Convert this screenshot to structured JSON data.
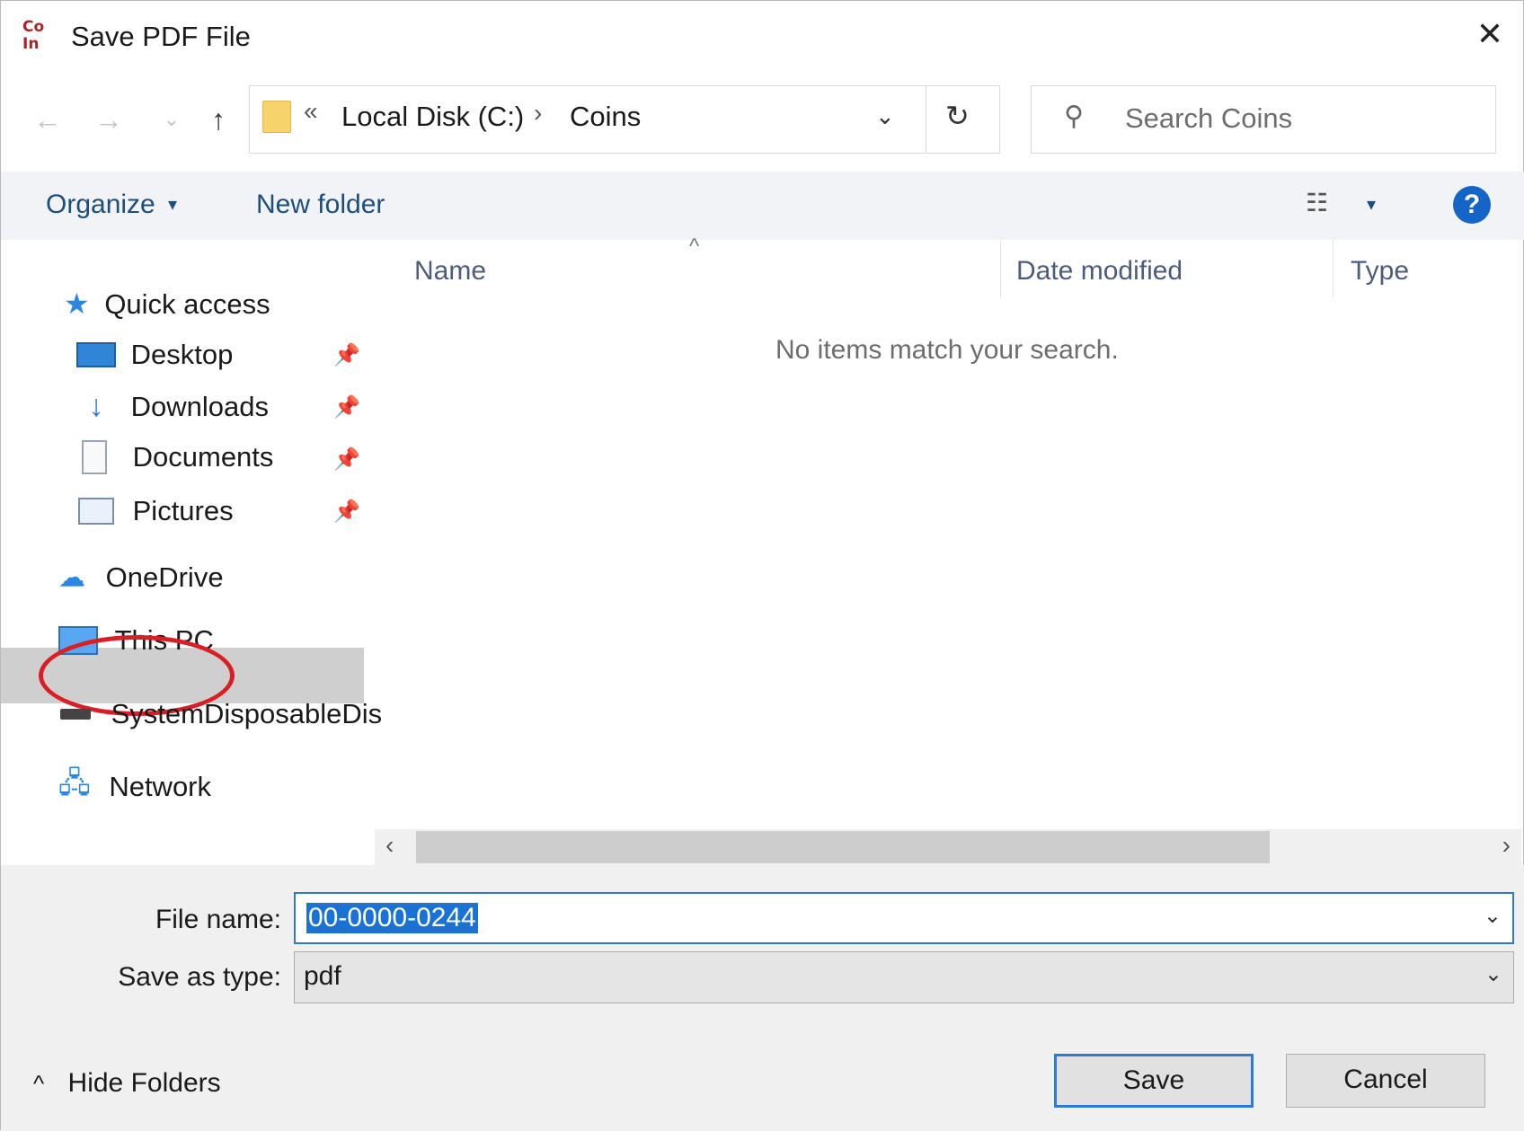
{
  "window": {
    "title": "Save PDF File",
    "app_icon_text": [
      "Co",
      "In"
    ]
  },
  "nav": {
    "back": "←",
    "forward": "→",
    "recent": "⌄",
    "up": "↑"
  },
  "address": {
    "overflow": "«",
    "segments": [
      "Local Disk (C:)",
      "Coins"
    ],
    "separator": "›",
    "dropdown": "⌄",
    "refresh": "↻"
  },
  "search": {
    "placeholder": "Search Coins",
    "icon": "⚲"
  },
  "toolbar": {
    "organize": "Organize",
    "new_folder": "New folder",
    "view_icon": "☷",
    "caret": "▾",
    "help": "?"
  },
  "sidebar": {
    "quick_access": "Quick access",
    "items": [
      {
        "label": "Desktop",
        "pinned": true
      },
      {
        "label": "Downloads",
        "pinned": true
      },
      {
        "label": "Documents",
        "pinned": true
      },
      {
        "label": "Pictures",
        "pinned": true
      }
    ],
    "onedrive": "OneDrive",
    "this_pc": "This PC",
    "disk": "SystemDisposableDis",
    "network": "Network",
    "pin_glyph": "📌"
  },
  "files": {
    "columns": [
      "Name",
      "Date modified",
      "Type"
    ],
    "empty_message": "No items match your search.",
    "sort_indicator": "^"
  },
  "form": {
    "file_name_label": "File name:",
    "file_name_value": "00-0000-0244",
    "save_type_label": "Save as type:",
    "save_type_value": "pdf",
    "dropdown_glyph": "⌄"
  },
  "footer": {
    "hide_folders": "Hide Folders",
    "hide_caret": "^",
    "save": "Save",
    "cancel": "Cancel"
  },
  "colors": {
    "accent": "#1565c8",
    "annotation": "#d81f26",
    "selection": "#1a73d4",
    "folder": "#f7d46b"
  }
}
